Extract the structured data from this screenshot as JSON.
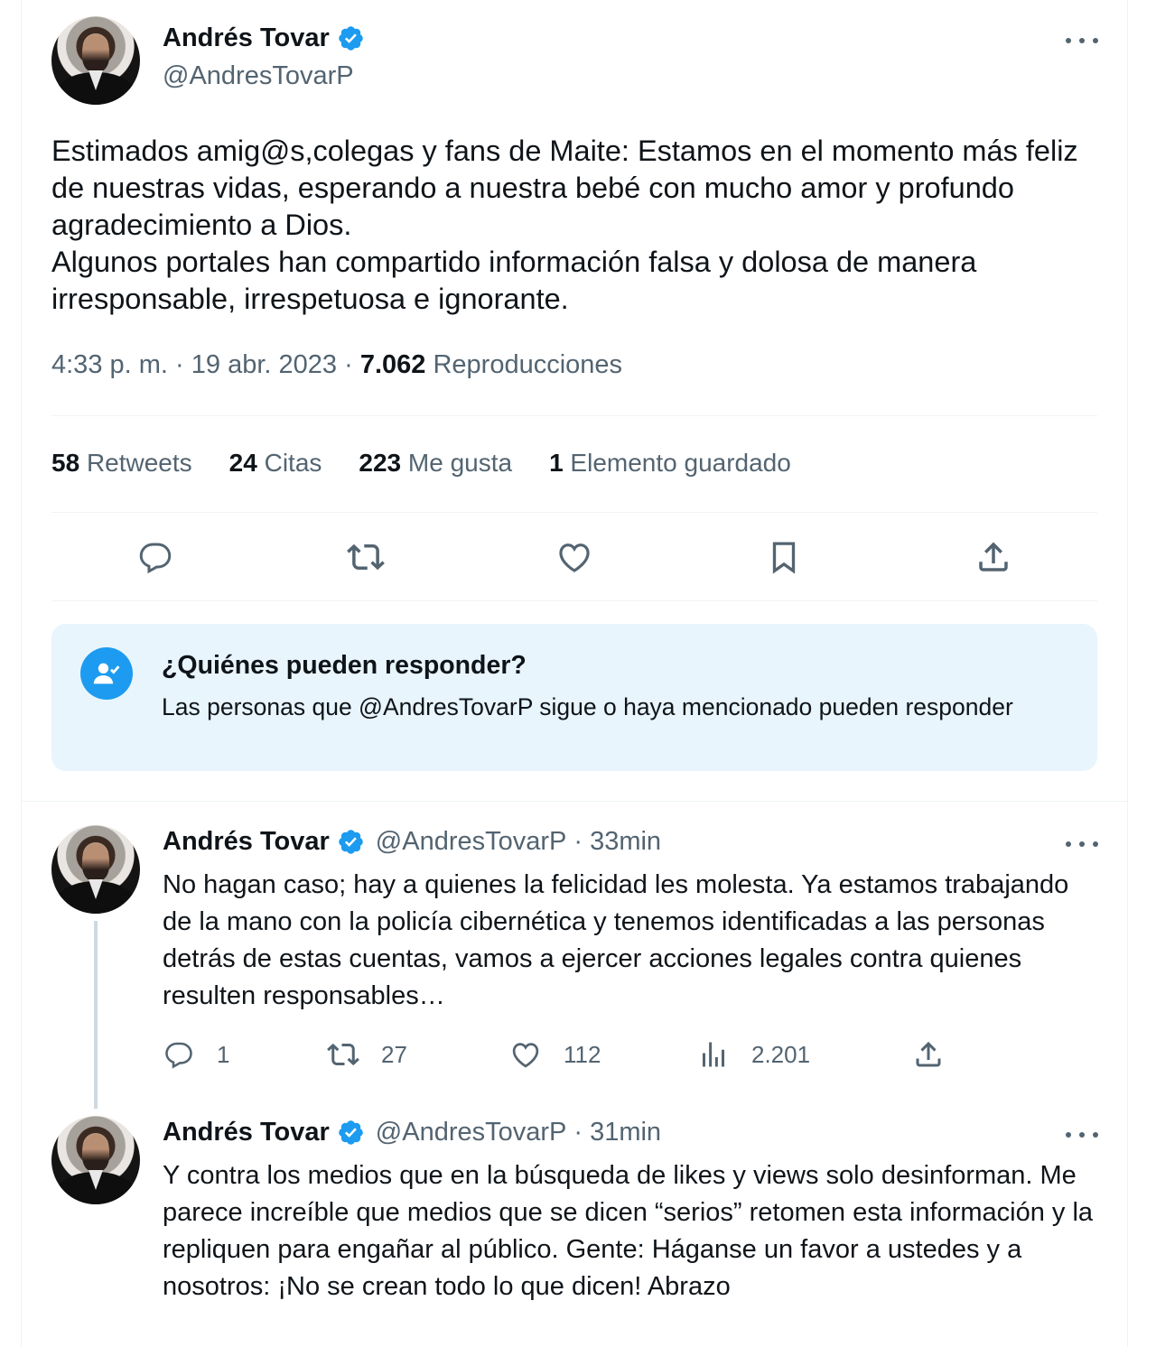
{
  "main_tweet": {
    "author_name": "Andrés Tovar",
    "author_handle": "@AndresTovarP",
    "text": "Estimados amig@s,colegas y fans de Maite: Estamos en el momento más feliz de nuestras vidas, esperando a nuestra bebé con mucho amor y profundo agradecimiento a Dios.\nAlgunos portales han compartido información falsa y dolosa de manera irresponsable, irrespetuosa e ignorante.",
    "time": "4:33 p. m.",
    "date": "19 abr. 2023",
    "views_count": "7.062",
    "views_label": "Reproducciones",
    "separator": "·",
    "stats": [
      {
        "count": "58",
        "label": "Retweets"
      },
      {
        "count": "24",
        "label": "Citas"
      },
      {
        "count": "223",
        "label": "Me gusta"
      },
      {
        "count": "1",
        "label": "Elemento guardado"
      }
    ],
    "action_icons": [
      "reply-icon",
      "retweet-icon",
      "like-icon",
      "bookmark-icon",
      "share-icon"
    ]
  },
  "who_can_reply": {
    "title": "¿Quiénes pueden responder?",
    "description": "Las personas que @AndresTovarP sigue o haya mencionado pueden responder",
    "icon": "user-check-icon"
  },
  "replies": [
    {
      "author_name": "Andrés Tovar",
      "author_handle": "@AndresTovarP",
      "time_ago": "33min",
      "text": "No hagan caso; hay a quienes la felicidad les molesta. Ya estamos trabajando de la mano con la policía cibernética y tenemos identificadas a las personas detrás de estas cuentas, vamos a ejercer acciones legales contra quienes resulten responsables…",
      "replies_count": "1",
      "retweets_count": "27",
      "likes_count": "112",
      "views_count": "2.201"
    },
    {
      "author_name": "Andrés Tovar",
      "author_handle": "@AndresTovarP",
      "time_ago": "31min",
      "text": "Y contra los medios que en la búsqueda de likes y views solo desinforman. Me parece increíble que medios que se dicen “serios” retomen esta información  y  la repliquen para engañar al público. Gente: Háganse un favor a ustedes y a nosotros: ¡No se crean todo lo que dicen! Abrazo"
    }
  ],
  "colors": {
    "accent": "#1d9bf0",
    "text_primary": "#0f1419",
    "text_secondary": "#536471",
    "who_box_bg": "#e8f5fd",
    "divider": "#eff3f4"
  }
}
